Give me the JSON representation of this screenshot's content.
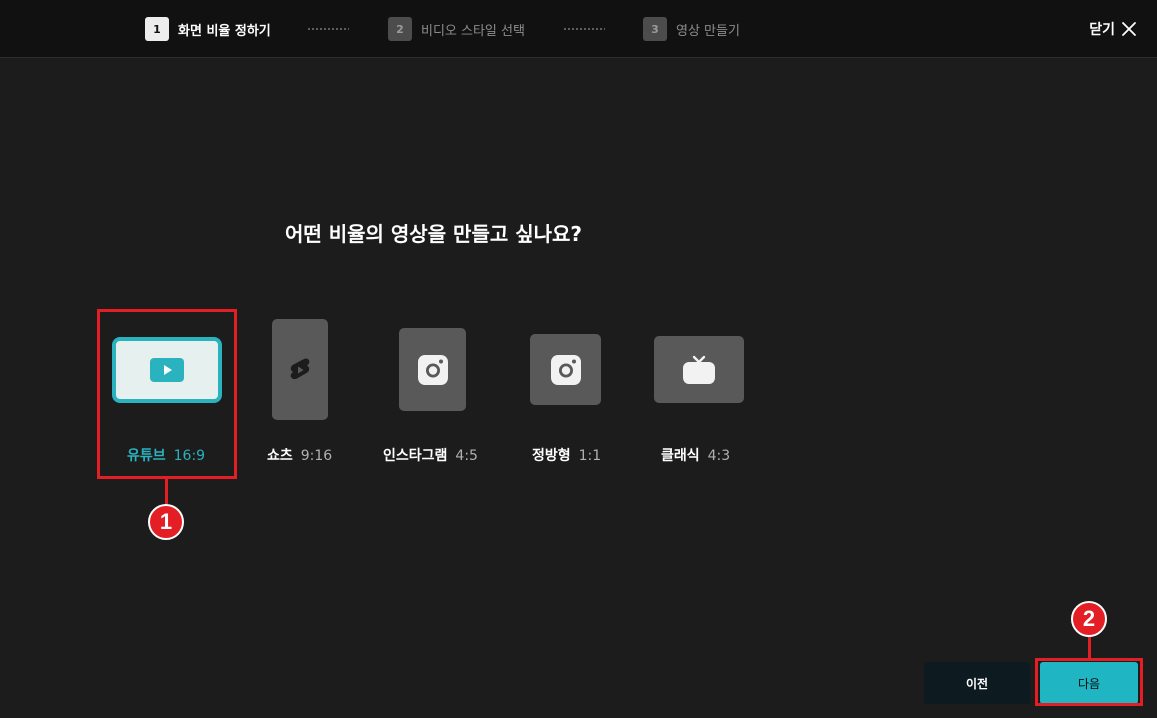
{
  "steps": [
    {
      "num": "1",
      "label": "화면 비율 정하기",
      "state": "active"
    },
    {
      "num": "2",
      "label": "비디오 스타일 선택",
      "state": "inactive"
    },
    {
      "num": "3",
      "label": "영상 만들기",
      "state": "inactive"
    }
  ],
  "close": {
    "label": "닫기",
    "icon": "close-icon"
  },
  "question": "어떤 비율의 영상을 만들고 싶나요?",
  "options": [
    {
      "name": "유튜브",
      "ratio": "16:9",
      "icon": "youtube-play-icon",
      "selected": true
    },
    {
      "name": "쇼츠",
      "ratio": "9:16",
      "icon": "shorts-icon",
      "selected": false
    },
    {
      "name": "인스타그램",
      "ratio": "4:5",
      "icon": "instagram-icon",
      "selected": false
    },
    {
      "name": "정방형",
      "ratio": "1:1",
      "icon": "instagram-icon",
      "selected": false
    },
    {
      "name": "클래식",
      "ratio": "4:3",
      "icon": "tv-icon",
      "selected": false
    }
  ],
  "annotations": [
    {
      "number": "1"
    },
    {
      "number": "2"
    }
  ],
  "buttons": {
    "prev": "이전",
    "next": "다음"
  },
  "colors": {
    "accent": "#2ab2bf",
    "highlight": "#e31e24",
    "background": "#1c1c1c"
  }
}
